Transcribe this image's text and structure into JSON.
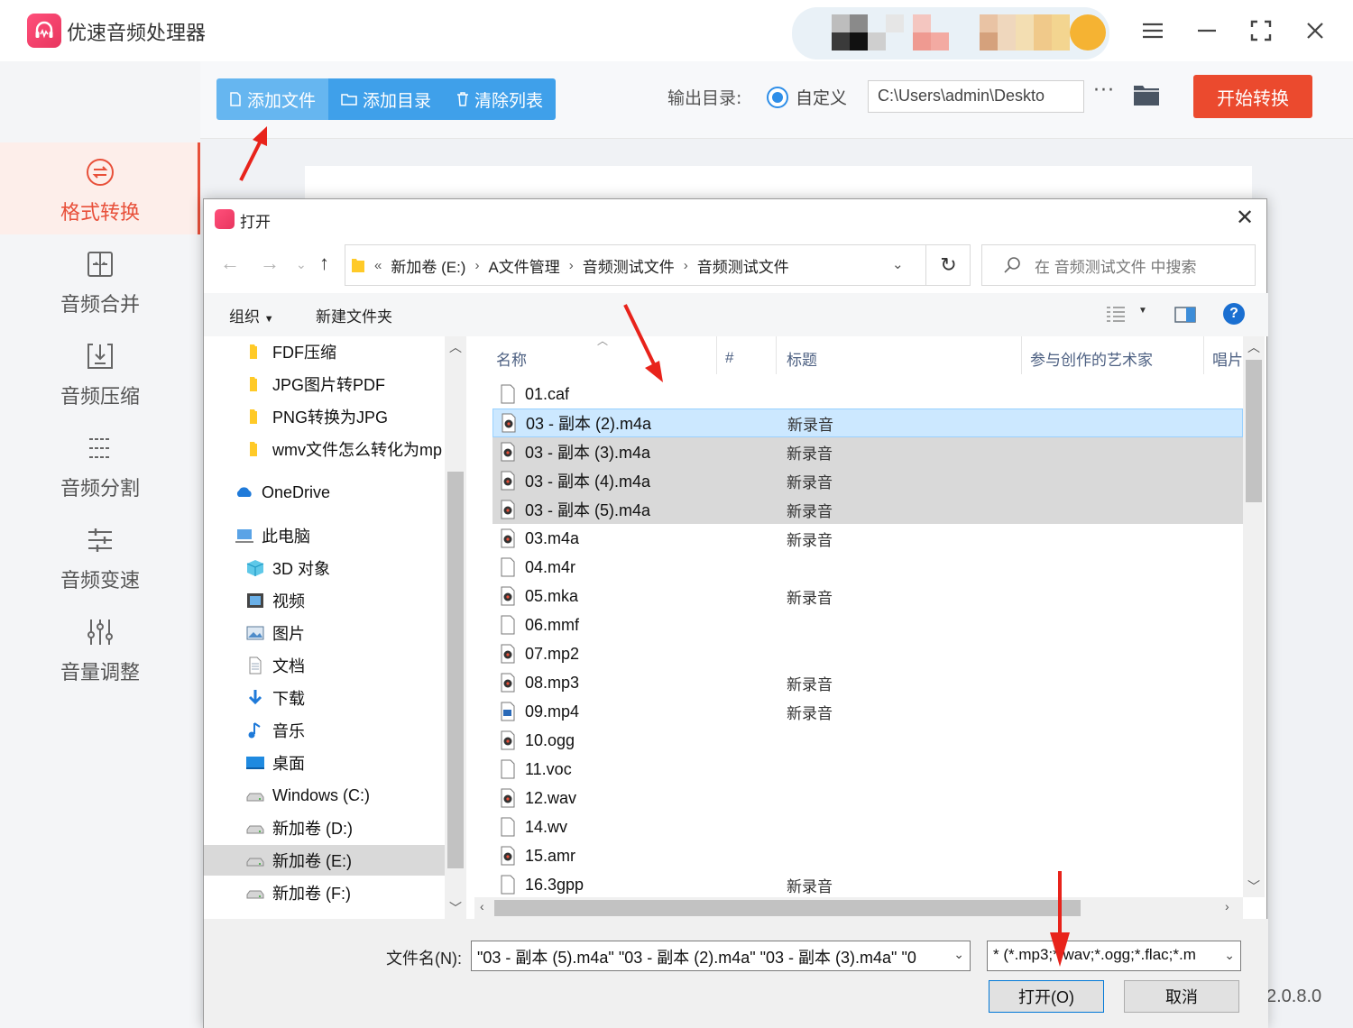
{
  "app": {
    "title": "优速音频处理器",
    "version": "2.0.8.0"
  },
  "window_controls": [
    "menu-icon",
    "minimize-icon",
    "fullscreen-icon",
    "close-icon"
  ],
  "sidebar": {
    "items": [
      {
        "label": "格式转换",
        "icon": "convert-icon",
        "active": true
      },
      {
        "label": "音频合并",
        "icon": "merge-icon",
        "active": false
      },
      {
        "label": "音频压缩",
        "icon": "compress-icon",
        "active": false
      },
      {
        "label": "音频分割",
        "icon": "split-icon",
        "active": false
      },
      {
        "label": "音频变速",
        "icon": "speed-icon",
        "active": false
      },
      {
        "label": "音量调整",
        "icon": "volume-icon",
        "active": false
      }
    ]
  },
  "toolbar": {
    "add_file": "添加文件",
    "add_folder": "添加目录",
    "clear_list": "清除列表",
    "output_label": "输出目录:",
    "output_option": "自定义",
    "output_path": "C:\\Users\\admin\\Deskto",
    "more": "···",
    "start": "开始转换"
  },
  "dialog": {
    "title": "打开",
    "breadcrumb": [
      "新加卷 (E:)",
      "A文件管理",
      "音频测试文件",
      "音频测试文件"
    ],
    "search_placeholder": "在 音频测试文件 中搜索",
    "organize": "组织",
    "new_folder": "新建文件夹",
    "tree": [
      {
        "label": "FDF压缩",
        "icon": "folder-icon",
        "indent": 2
      },
      {
        "label": "JPG图片转PDF",
        "icon": "folder-icon",
        "indent": 2
      },
      {
        "label": "PNG转换为JPG",
        "icon": "folder-icon",
        "indent": 2
      },
      {
        "label": "wmv文件怎么转化为mp",
        "icon": "folder-icon",
        "indent": 2
      },
      {
        "label": "OneDrive",
        "icon": "cloud-icon",
        "indent": 1
      },
      {
        "label": "此电脑",
        "icon": "computer-icon",
        "indent": 1
      },
      {
        "label": "3D 对象",
        "icon": "cube-icon",
        "indent": 2
      },
      {
        "label": "视频",
        "icon": "video-icon",
        "indent": 2
      },
      {
        "label": "图片",
        "icon": "picture-icon",
        "indent": 2
      },
      {
        "label": "文档",
        "icon": "document-icon",
        "indent": 2
      },
      {
        "label": "下载",
        "icon": "download-icon",
        "indent": 2
      },
      {
        "label": "音乐",
        "icon": "music-icon",
        "indent": 2
      },
      {
        "label": "桌面",
        "icon": "desktop-icon",
        "indent": 2
      },
      {
        "label": "Windows (C:)",
        "icon": "drive-icon",
        "indent": 2
      },
      {
        "label": "新加卷 (D:)",
        "icon": "drive-icon",
        "indent": 2
      },
      {
        "label": "新加卷 (E:)",
        "icon": "drive-icon",
        "indent": 2,
        "selected": true
      },
      {
        "label": "新加卷 (F:)",
        "icon": "drive-icon",
        "indent": 2
      }
    ],
    "columns": [
      "名称",
      "#",
      "标题",
      "参与创作的艺术家",
      "唱片"
    ],
    "files": [
      {
        "name": "01.caf",
        "title": "",
        "icon": "blank-file-icon",
        "state": ""
      },
      {
        "name": "03 - 副本 (2).m4a",
        "title": "新录音",
        "icon": "media-file-icon",
        "state": "hl"
      },
      {
        "name": "03 - 副本 (3).m4a",
        "title": "新录音",
        "icon": "media-file-icon",
        "state": "sel"
      },
      {
        "name": "03 - 副本 (4).m4a",
        "title": "新录音",
        "icon": "media-file-icon",
        "state": "sel"
      },
      {
        "name": "03 - 副本 (5).m4a",
        "title": "新录音",
        "icon": "media-file-icon",
        "state": "sel"
      },
      {
        "name": "03.m4a",
        "title": "新录音",
        "icon": "media-file-icon",
        "state": ""
      },
      {
        "name": "04.m4r",
        "title": "",
        "icon": "blank-file-icon",
        "state": ""
      },
      {
        "name": "05.mka",
        "title": "新录音",
        "icon": "media-file-icon",
        "state": ""
      },
      {
        "name": "06.mmf",
        "title": "",
        "icon": "blank-file-icon",
        "state": ""
      },
      {
        "name": "07.mp2",
        "title": "",
        "icon": "media-file-icon",
        "state": ""
      },
      {
        "name": "08.mp3",
        "title": "新录音",
        "icon": "media-file-icon",
        "state": ""
      },
      {
        "name": "09.mp4",
        "title": "新录音",
        "icon": "video-file-icon",
        "state": ""
      },
      {
        "name": "10.ogg",
        "title": "",
        "icon": "media-file-icon",
        "state": ""
      },
      {
        "name": "11.voc",
        "title": "",
        "icon": "blank-file-icon",
        "state": ""
      },
      {
        "name": "12.wav",
        "title": "",
        "icon": "media-file-icon",
        "state": ""
      },
      {
        "name": "14.wv",
        "title": "",
        "icon": "blank-file-icon",
        "state": ""
      },
      {
        "name": "15.amr",
        "title": "",
        "icon": "media-file-icon",
        "state": ""
      },
      {
        "name": "16.3gpp",
        "title": "新录音",
        "icon": "blank-file-icon",
        "state": ""
      }
    ],
    "filename_label": "文件名(N):",
    "filename_value": "\"03 - 副本 (5).m4a\" \"03 - 副本 (2).m4a\" \"03 - 副本 (3).m4a\" \"0",
    "filetype_value": "* (*.mp3;*.wav;*.ogg;*.flac;*.m",
    "open_button": "打开(O)",
    "cancel_button": "取消"
  },
  "colors": {
    "accent_blue": "#3fa0ea",
    "start_red": "#eb4a2e",
    "active_nav": "#e8503a",
    "selection_blue": "#cce8ff",
    "selection_gray": "#d9d9d9"
  }
}
